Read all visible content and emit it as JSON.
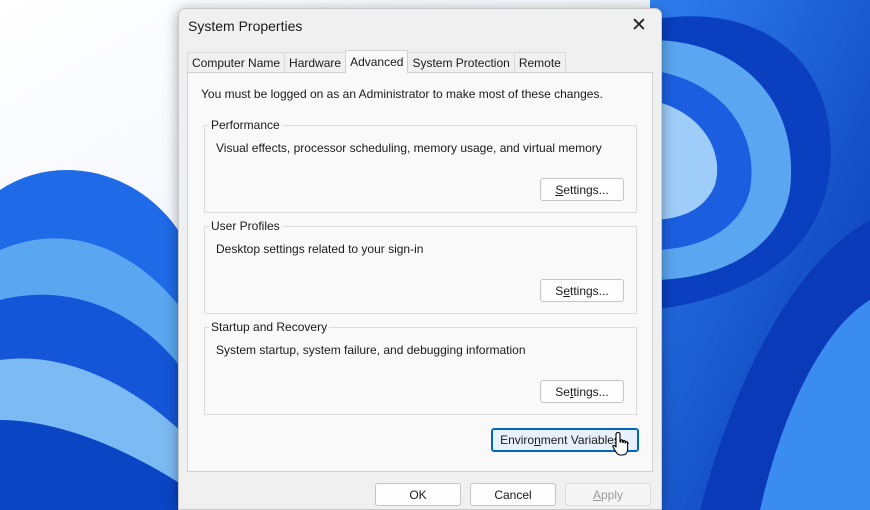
{
  "window": {
    "title": "System Properties",
    "close_glyph": "✕"
  },
  "tabs": [
    {
      "label": "Computer Name",
      "active": false
    },
    {
      "label": "Hardware",
      "active": false
    },
    {
      "label": "Advanced",
      "active": true
    },
    {
      "label": "System Protection",
      "active": false
    },
    {
      "label": "Remote",
      "active": false
    }
  ],
  "advanced": {
    "admin_note": "You must be logged on as an Administrator to make most of these changes.",
    "groups": [
      {
        "label": "Performance",
        "description": "Visual effects, processor scheduling, memory usage, and virtual memory",
        "button": {
          "pre": "",
          "mnemonic": "S",
          "post": "ettings..."
        }
      },
      {
        "label": "User Profiles",
        "description": "Desktop settings related to your sign-in",
        "button": {
          "pre": "S",
          "mnemonic": "e",
          "post": "ttings..."
        }
      },
      {
        "label": "Startup and Recovery",
        "description": "System startup, system failure, and debugging information",
        "button": {
          "pre": "Se",
          "mnemonic": "t",
          "post": "tings..."
        }
      }
    ],
    "env_button": {
      "pre": "Enviro",
      "mnemonic": "n",
      "post": "ment Variables..."
    }
  },
  "footer": {
    "ok_label": "OK",
    "cancel_label": "Cancel",
    "apply": {
      "pre": "",
      "mnemonic": "A",
      "post": "pply"
    }
  },
  "colors": {
    "accent": "#0067c0",
    "wallpaper_blue": "#0a50d8",
    "wallpaper_light": "#5aa6f0"
  },
  "icons": {
    "close": "close-icon",
    "cursor": "hand-pointer-cursor"
  }
}
